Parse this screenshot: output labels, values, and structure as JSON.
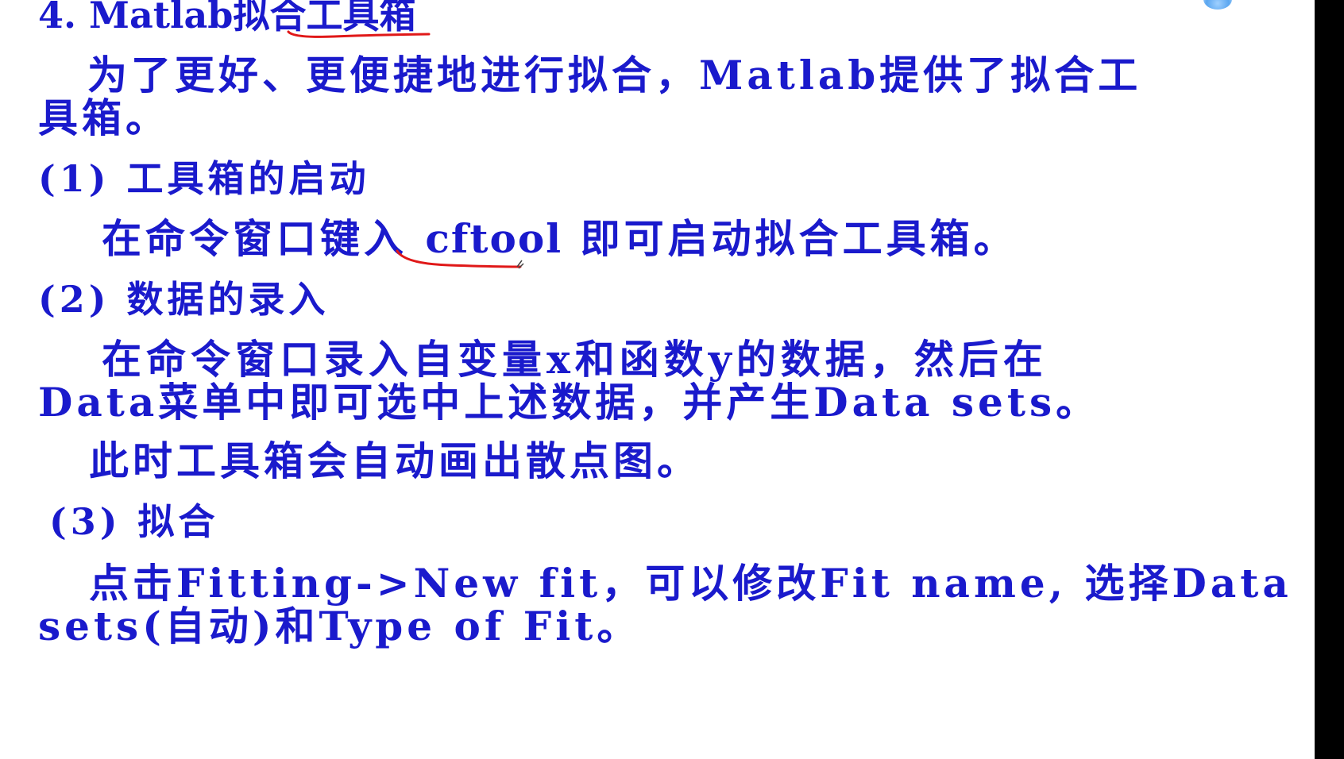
{
  "slide": {
    "heading": "4. Matlab拟合工具箱",
    "intro_line1": "为了更好、更便捷地进行拟合，Matlab提供了拟合工",
    "intro_line2": "具箱。",
    "section1": {
      "title": "(1) 工具箱的启动",
      "text_before": "在命令窗口键入",
      "command": "cftool",
      "text_after": "即可启动拟合工具箱。"
    },
    "section2": {
      "title": "(2) 数据的录入",
      "line1": "在命令窗口录入自变量x和函数y的数据，然后在",
      "line2": "Data菜单中即可选中上述数据，并产生Data sets。",
      "line3": "此时工具箱会自动画出散点图。"
    },
    "section3": {
      "title": "(3) 拟合",
      "line1": "点击Fitting->New fit，可以修改Fit name, 选择Data",
      "line2": "sets(自动)和Type of Fit。"
    }
  },
  "colors": {
    "text": "#1a1acc",
    "annotation": "#e01818",
    "background": "#ffffff",
    "right_bar": "#000000"
  }
}
